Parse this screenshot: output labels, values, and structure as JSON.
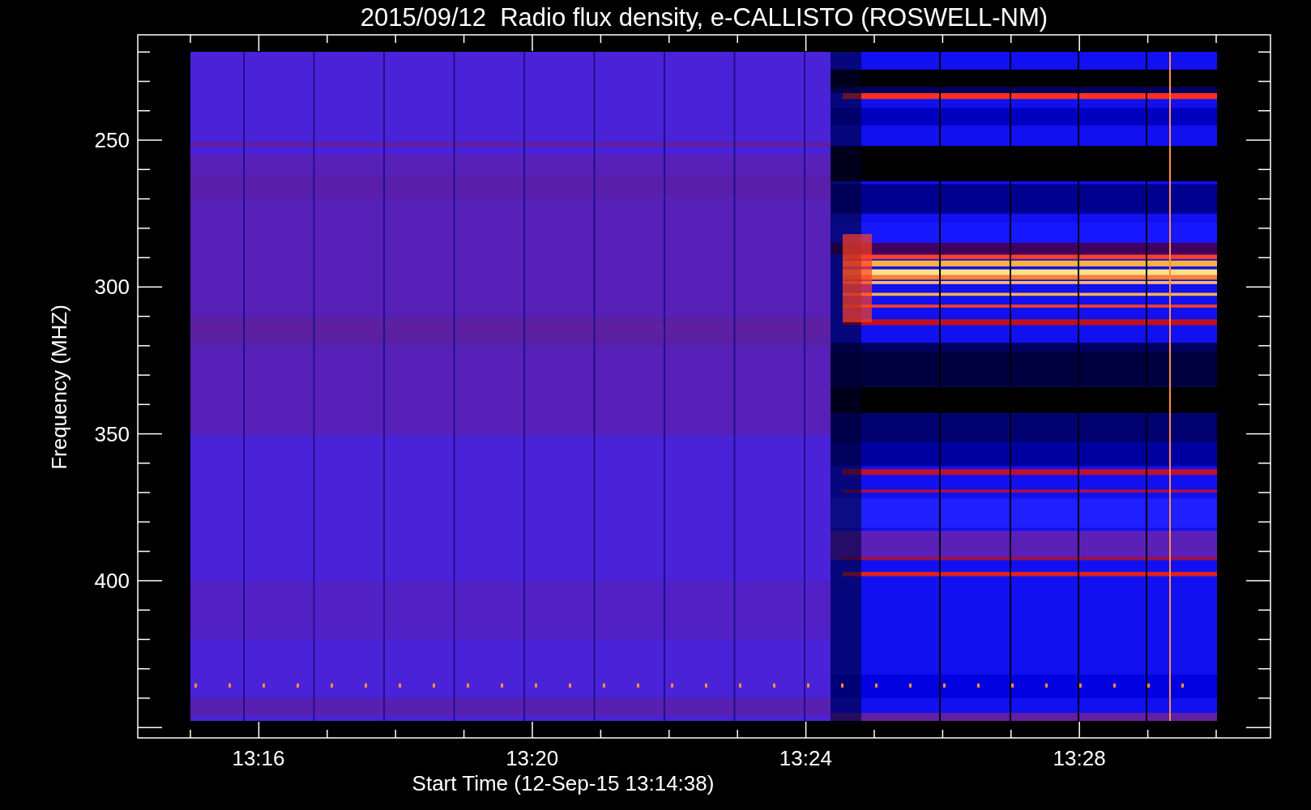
{
  "plot": {
    "title": "2015/09/12  Radio flux density, e-CALLISTO (ROSWELL-NM)",
    "x_axis": {
      "label": "Start Time (12-Sep-15 13:14:38)",
      "ticks": [
        "13:16",
        "13:20",
        "13:24",
        "13:28"
      ]
    },
    "y_axis": {
      "label": "Frequency (MHZ)",
      "ticks": [
        "250",
        "300",
        "350",
        "400"
      ]
    }
  }
}
